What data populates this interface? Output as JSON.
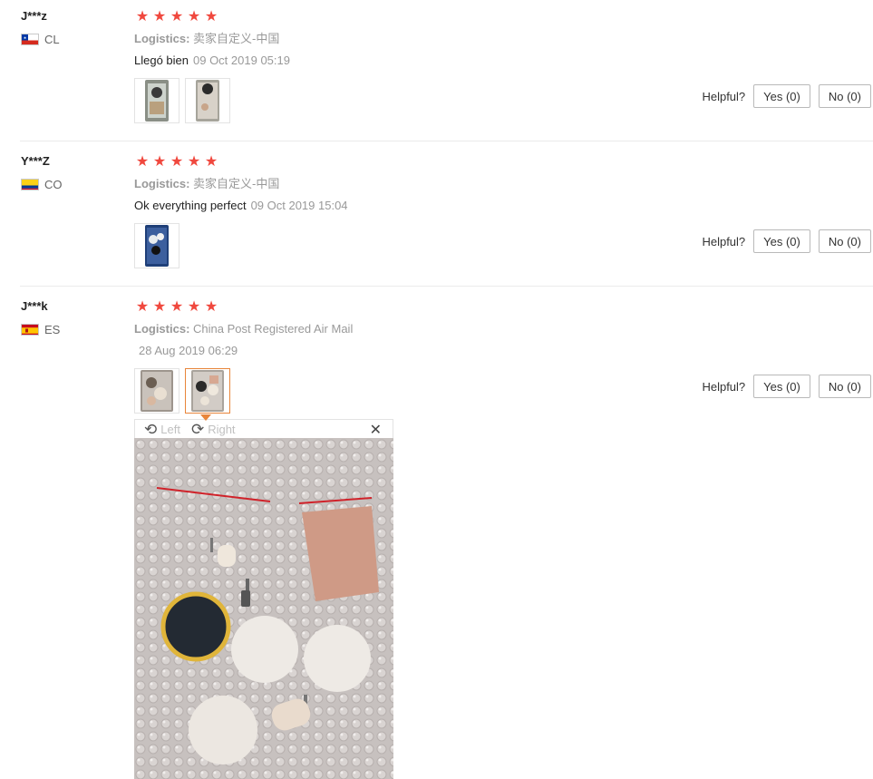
{
  "helpful_label": "Helpful?",
  "viewer": {
    "left_label": "Left",
    "right_label": "Right",
    "close_glyph": "✕",
    "rotate_left_glyph": "⟲",
    "rotate_right_glyph": "⟳"
  },
  "reviews": [
    {
      "user": "J***z",
      "country": "CL",
      "rating": 5,
      "logistics_label": "Logistics:",
      "logistics": "卖家自定义-中国",
      "text": "Llegó bien",
      "date": "09 Oct 2019 05:19",
      "yes": "Yes (0)",
      "no": "No (0)"
    },
    {
      "user": "Y***Z",
      "country": "CO",
      "rating": 5,
      "logistics_label": "Logistics:",
      "logistics": "卖家自定义-中国",
      "text": "Ok everything perfect",
      "date": "09 Oct 2019 15:04",
      "yes": "Yes (0)",
      "no": "No (0)"
    },
    {
      "user": "J***k",
      "country": "ES",
      "rating": 5,
      "logistics_label": "Logistics:",
      "logistics": "China Post Registered Air Mail",
      "text": "",
      "date": "28 Aug 2019 06:29",
      "yes": "Yes (0)",
      "no": "No (0)"
    }
  ],
  "star_glyph": "★",
  "colors": {
    "star": "#f0483e",
    "active_thumb": "#e8853a",
    "divider": "#ebebeb"
  }
}
